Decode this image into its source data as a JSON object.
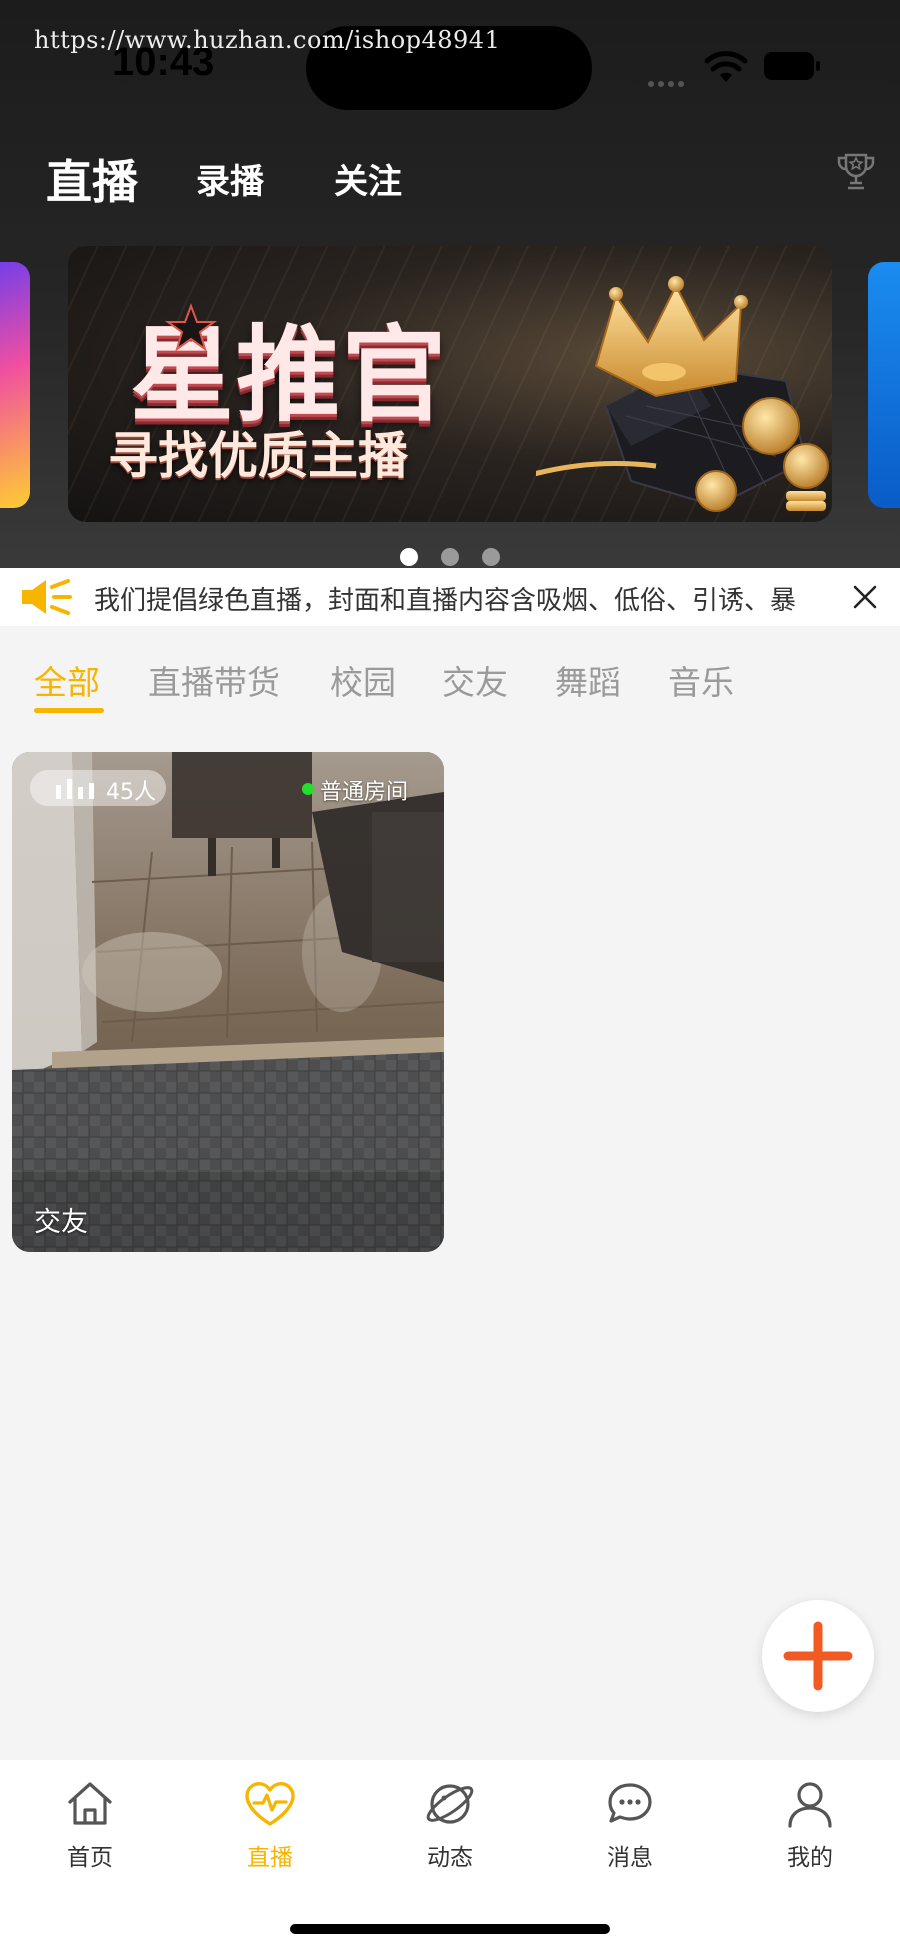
{
  "watermark": "https://www.huzhan.com/ishop48941",
  "status_bar": {
    "time": "10:43"
  },
  "top_tabs": [
    {
      "label": "直播",
      "active": true
    },
    {
      "label": "录播",
      "active": false
    },
    {
      "label": "关注",
      "active": false
    }
  ],
  "banner": {
    "title": "星推官",
    "subtitle": "寻找优质主播",
    "page_count": 3,
    "active_index": 0
  },
  "notice": {
    "text": "我们提倡绿色直播，封面和直播内容含吸烟、低俗、引诱、暴"
  },
  "categories": [
    {
      "label": "全部",
      "active": true
    },
    {
      "label": "直播带货",
      "active": false
    },
    {
      "label": "校园",
      "active": false
    },
    {
      "label": "交友",
      "active": false
    },
    {
      "label": "舞蹈",
      "active": false
    },
    {
      "label": "音乐",
      "active": false
    }
  ],
  "live_rooms": [
    {
      "viewers": "45人",
      "room_type": "普通房间",
      "category": "交友"
    }
  ],
  "bottom_nav": [
    {
      "label": "首页",
      "icon": "home-icon",
      "active": false
    },
    {
      "label": "直播",
      "icon": "heart-pulse-icon",
      "active": true
    },
    {
      "label": "动态",
      "icon": "planet-icon",
      "active": false
    },
    {
      "label": "消息",
      "icon": "chat-bubble-icon",
      "active": false
    },
    {
      "label": "我的",
      "icon": "user-icon",
      "active": false
    }
  ],
  "colors": {
    "accent": "#f7b500",
    "fab_plus": "#f25a24",
    "live_dot": "#22e02a",
    "inactive_text": "#9a9a9a"
  }
}
